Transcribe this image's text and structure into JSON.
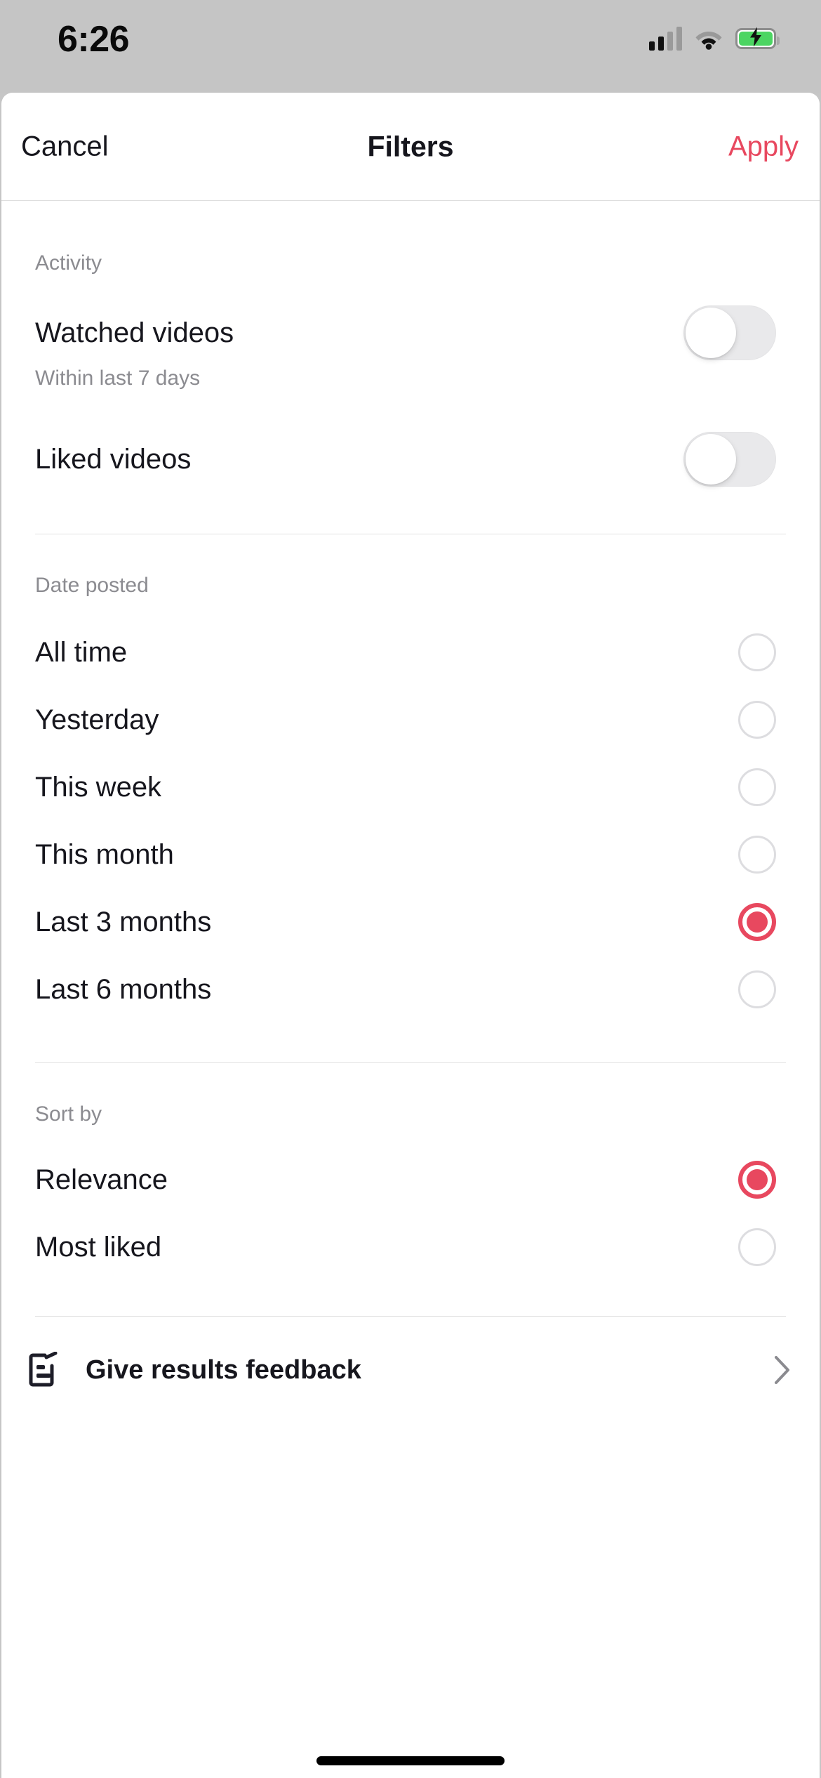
{
  "status_bar": {
    "time": "6:26",
    "cellular_icon": "cellular-signal-icon",
    "wifi_icon": "wifi-icon",
    "battery_icon": "battery-charging-icon",
    "battery_color": "#4cd562"
  },
  "header": {
    "cancel_label": "Cancel",
    "title": "Filters",
    "apply_label": "Apply",
    "accent_color": "#e8485f"
  },
  "sections": [
    {
      "label": "Activity",
      "rows": [
        {
          "label": "Watched videos",
          "sublabel": "Within last 7 days",
          "control": "toggle",
          "state": "off"
        },
        {
          "label": "Liked videos",
          "sublabel": "",
          "control": "toggle",
          "state": "off"
        }
      ]
    },
    {
      "label": "Date posted",
      "rows": [
        {
          "label": "All time",
          "control": "radio",
          "state": "off"
        },
        {
          "label": "Yesterday",
          "control": "radio",
          "state": "off"
        },
        {
          "label": "This week",
          "control": "radio",
          "state": "off"
        },
        {
          "label": "This month",
          "control": "radio",
          "state": "off"
        },
        {
          "label": "Last 3 months",
          "control": "radio",
          "state": "on"
        },
        {
          "label": "Last 6 months",
          "control": "radio",
          "state": "off"
        }
      ]
    },
    {
      "label": "Sort by",
      "rows": [
        {
          "label": "Relevance",
          "control": "radio",
          "state": "on"
        },
        {
          "label": "Most liked",
          "control": "radio",
          "state": "off"
        }
      ]
    }
  ],
  "footer": {
    "icon": "feedback-note-icon",
    "label": "Give results feedback",
    "chevron": "chevron-right-icon"
  }
}
